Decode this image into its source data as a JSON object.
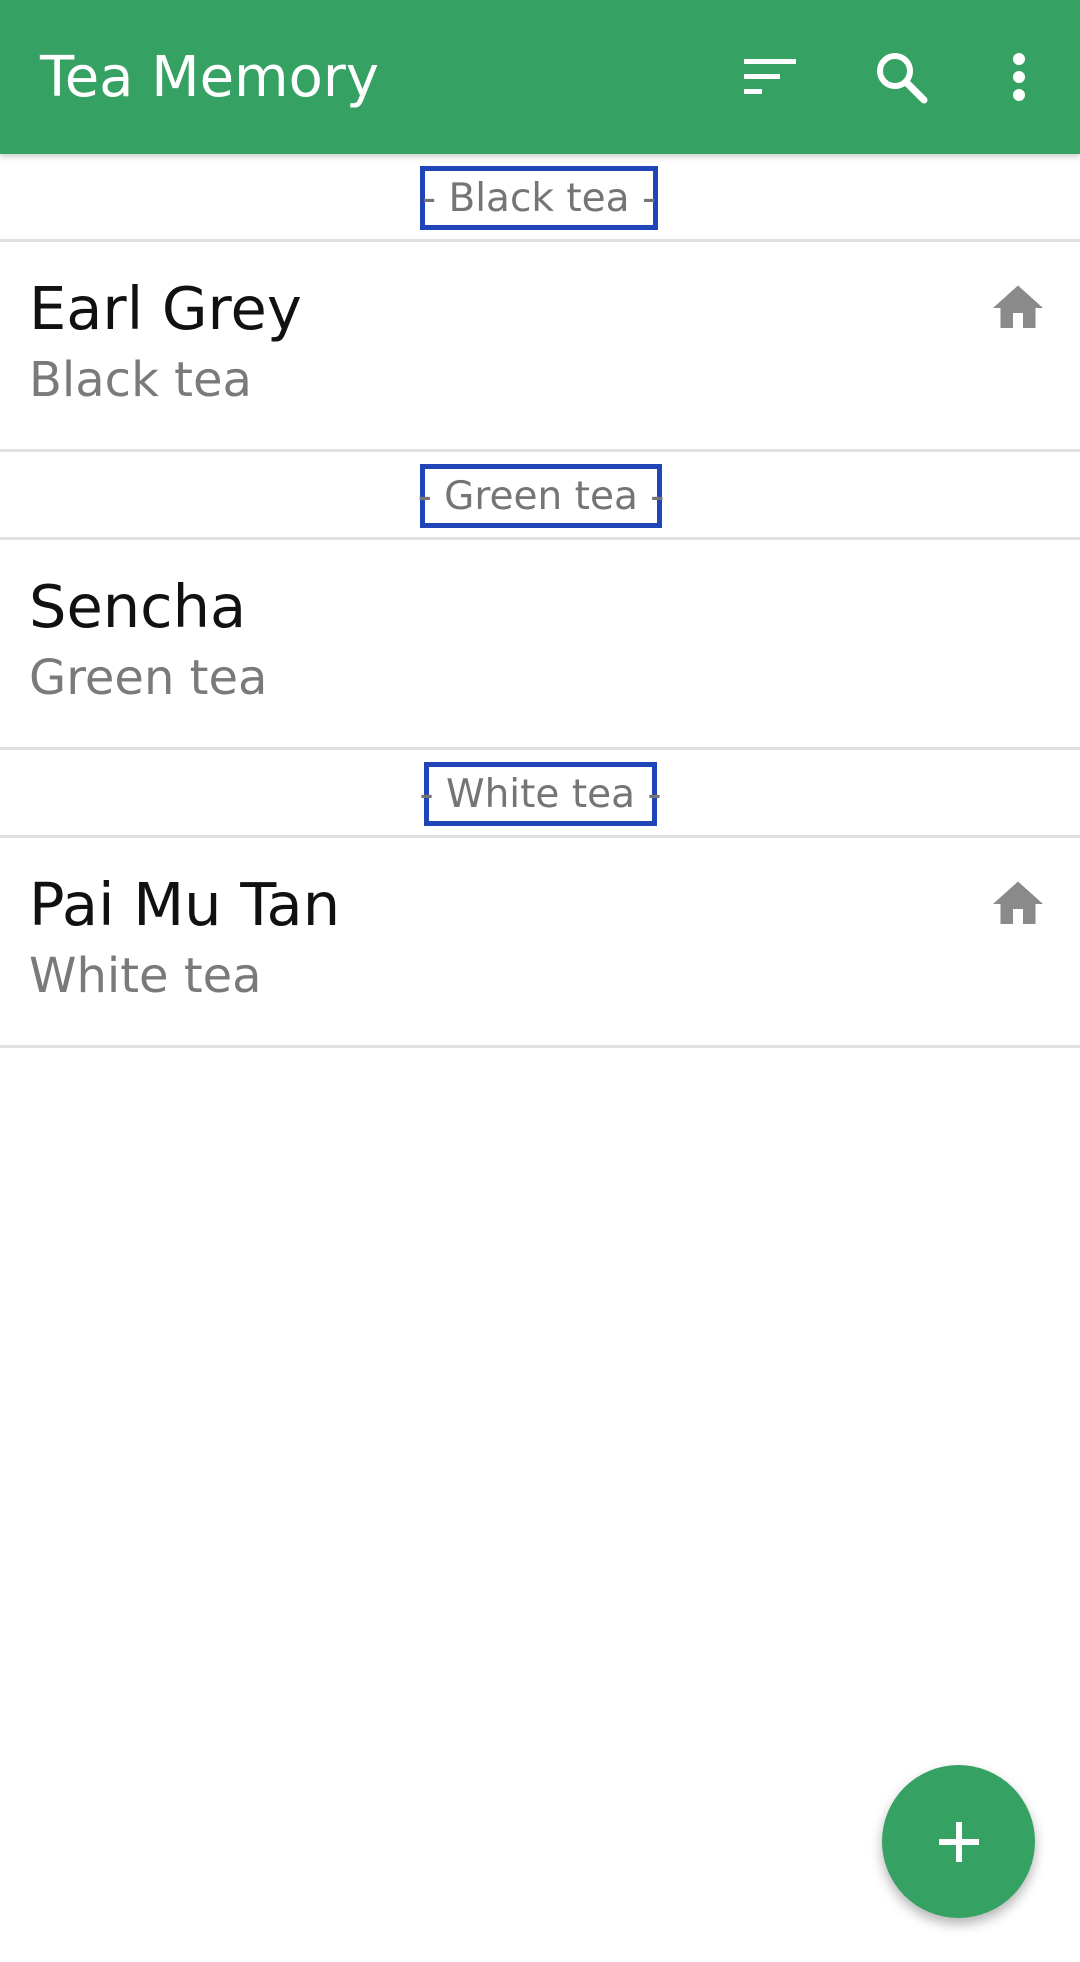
{
  "appbar": {
    "title": "Tea Memory",
    "color": "#35a163",
    "actions": [
      {
        "name": "sort-icon"
      },
      {
        "name": "search-icon"
      },
      {
        "name": "more-vert-icon"
      }
    ]
  },
  "sections": [
    {
      "header": "- Black tea -",
      "items": [
        {
          "name": "Earl Grey",
          "type": "Black tea",
          "in_stock_icon": "home-icon"
        }
      ]
    },
    {
      "header": "- Green tea -",
      "items": [
        {
          "name": "Sencha",
          "type": "Green tea"
        }
      ]
    },
    {
      "header": "- White tea -",
      "items": [
        {
          "name": "Pai Mu Tan",
          "type": "White tea",
          "in_stock_icon": "home-icon"
        }
      ]
    }
  ],
  "fab": {
    "icon": "plus-icon"
  },
  "colors": {
    "accent": "#35a163",
    "header_outline": "#1f45b8",
    "divider": "#e0e0e0",
    "secondary_text": "#7a7a7a",
    "icon_gray": "#8a8a8a"
  }
}
